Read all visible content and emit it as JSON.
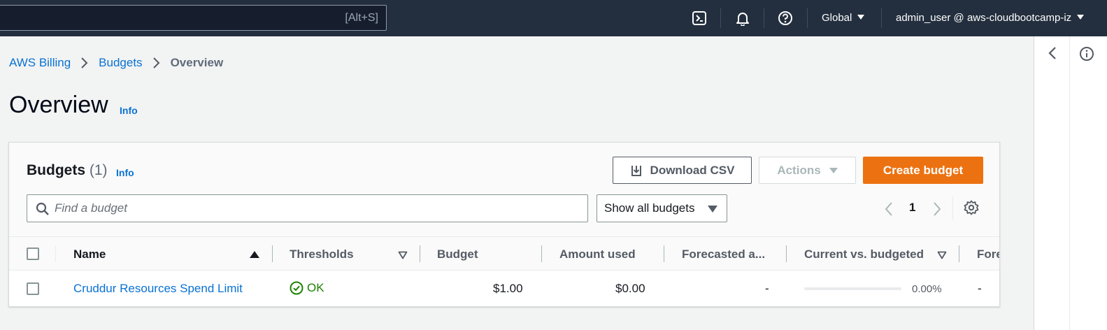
{
  "topnav": {
    "search_shortcut": "[Alt+S]",
    "region_label": "Global",
    "account_label": "admin_user @ aws-cloudbootcamp-iz",
    "icons": [
      "cloudshell-icon",
      "bell-icon",
      "help-icon"
    ]
  },
  "breadcrumb": {
    "items": [
      "AWS Billing",
      "Budgets",
      "Overview"
    ]
  },
  "page": {
    "title": "Overview",
    "info": "Info"
  },
  "budgets_panel": {
    "title": "Budgets",
    "count": "(1)",
    "info": "Info",
    "download_csv_label": "Download CSV",
    "actions_label": "Actions",
    "create_budget_label": "Create budget",
    "search_placeholder": "Find a budget",
    "search_value": "",
    "filter_selected": "Show all budgets",
    "current_page": "1"
  },
  "table": {
    "columns": [
      "Name",
      "Thresholds",
      "Budget",
      "Amount used",
      "Forecasted a...",
      "Current vs. budgeted",
      "Fore"
    ],
    "rows": [
      {
        "name": "Cruddur Resources Spend Limit",
        "thresholds": "OK",
        "budget": "$1.00",
        "amount_used": "$0.00",
        "forecasted": "-",
        "current_vs_budgeted": "0.00%",
        "current_vs_budgeted_fraction": 0.0,
        "fore": "-"
      }
    ]
  },
  "colors": {
    "nav_bg": "#232f3e",
    "link": "#0972d3",
    "primary": "#ec7211",
    "ok": "#1d8102"
  }
}
